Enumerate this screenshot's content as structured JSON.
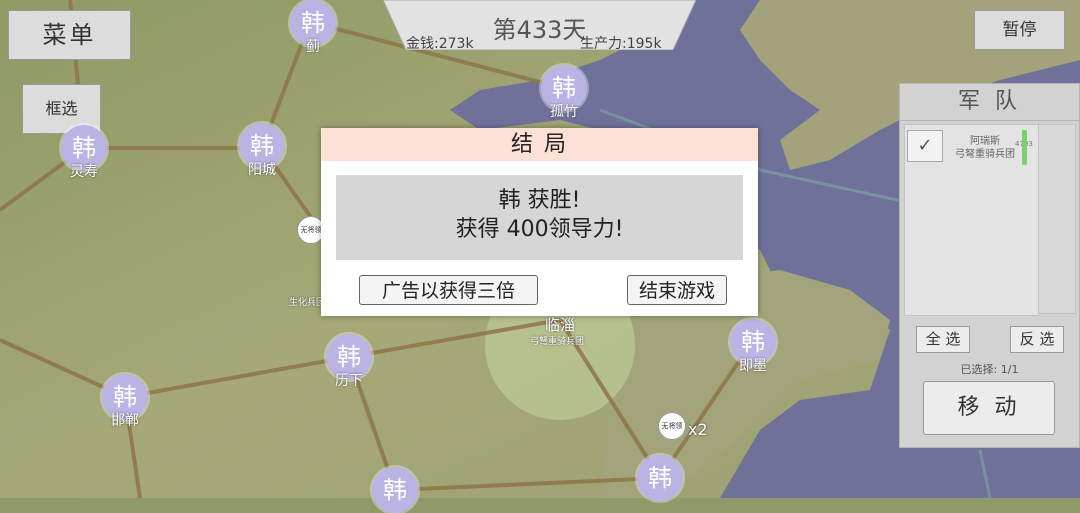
{
  "topbar": {
    "day": "第433天",
    "money": "金钱:273k",
    "production": "生产力:195k"
  },
  "buttons": {
    "menu": "菜单",
    "box_select": "框选",
    "pause": "暂停"
  },
  "cities": [
    {
      "badge": "韩",
      "name": "蓟"
    },
    {
      "badge": "韩",
      "name": "孤竹"
    },
    {
      "badge": "韩",
      "name": "灵寿"
    },
    {
      "badge": "韩",
      "name": "阳城"
    },
    {
      "badge": "韩",
      "name": "临淄"
    },
    {
      "badge": "韩",
      "name": "历下"
    },
    {
      "badge": "韩",
      "name": "即墨"
    },
    {
      "badge": "韩",
      "name": "邯郸"
    },
    {
      "badge": "韩",
      "name": ""
    },
    {
      "badge": "韩",
      "name": ""
    }
  ],
  "map_labels": {
    "pin1": "无将领",
    "pin2": "无将领",
    "pin2_count": "x2",
    "unit_label1": "生化兵团",
    "unit_label2": "弓弩重骑兵团"
  },
  "dialog": {
    "title": "结 局",
    "line1": "韩 获胜!",
    "line2": "获得 400领导力!",
    "ad_button": "广告以获得三倍",
    "end_button": "结束游戏"
  },
  "army": {
    "title": "军 队",
    "unit_name": "阿瑞斯",
    "unit_type": "弓弩重骑兵团",
    "unit_count": "4793",
    "select_all": "全 选",
    "invert": "反 选",
    "selected": "已选择: 1/1",
    "move": "移 动"
  }
}
